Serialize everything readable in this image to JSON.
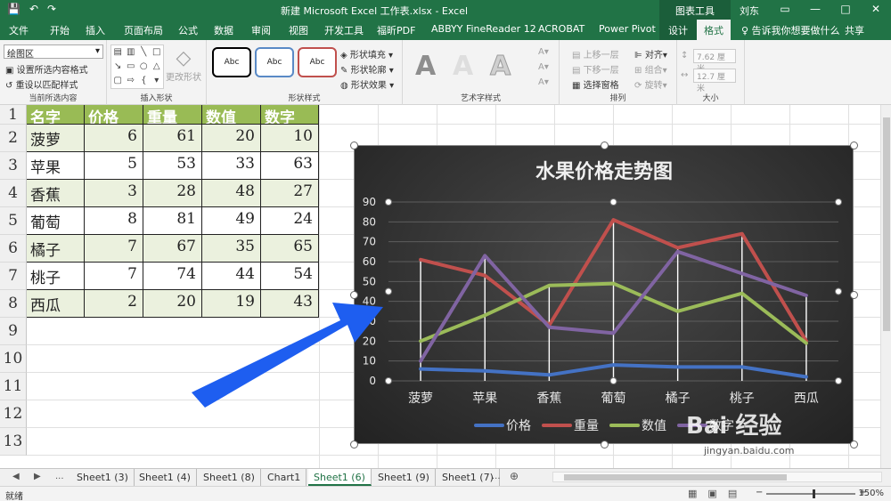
{
  "titlebar": {
    "title": "新建 Microsoft Excel 工作表.xlsx  -  Excel",
    "context_tools": "图表工具",
    "user": "刘东",
    "qat_save": "💾",
    "qat_undo": "↶",
    "qat_redo": "↷",
    "win_restore": "▭",
    "win_min": "—",
    "win_max": "□",
    "win_close": "✕"
  },
  "tabs": [
    {
      "label": "文件"
    },
    {
      "label": "开始"
    },
    {
      "label": "插入"
    },
    {
      "label": "页面布局"
    },
    {
      "label": "公式"
    },
    {
      "label": "数据"
    },
    {
      "label": "审阅"
    },
    {
      "label": "视图"
    },
    {
      "label": "开发工具"
    },
    {
      "label": "福昕PDF"
    },
    {
      "label": "ABBYY FineReader 12"
    },
    {
      "label": "ACROBAT"
    },
    {
      "label": "Power Pivot"
    },
    {
      "label": "设计"
    },
    {
      "label": "格式"
    }
  ],
  "tell_me": "♀ 告诉我你想要做什么",
  "share": "共享",
  "ribbon": {
    "current_selection": {
      "dropdown_value": "绘图区",
      "format_selection": "设置所选内容格式",
      "reset_style": "重设以匹配样式",
      "label": "当前所选内容"
    },
    "insert_shapes": {
      "change_shape": "更改形状",
      "label": "插入形状"
    },
    "shape_styles": {
      "samples": [
        "Abc",
        "Abc",
        "Abc"
      ],
      "fill": "形状填充",
      "outline": "形状轮廓",
      "effects": "形状效果",
      "label": "形状样式"
    },
    "wordart": {
      "letters": [
        "A",
        "A",
        "A"
      ],
      "label": "艺术字样式"
    },
    "arrange": {
      "bring_forward": "上移一层",
      "send_backward": "下移一层",
      "selection_pane": "选择窗格",
      "align": "对齐",
      "group": "组合",
      "rotate": "旋转",
      "label": "排列"
    },
    "size": {
      "height": "7.62 厘米",
      "width": "12.7 厘米",
      "label": "大小"
    }
  },
  "table": {
    "headers": [
      "名字",
      "价格",
      "重量",
      "数值",
      "数字"
    ],
    "rows": [
      {
        "name": "菠萝",
        "v": [
          6,
          61,
          20,
          10
        ]
      },
      {
        "name": "苹果",
        "v": [
          5,
          53,
          33,
          63
        ]
      },
      {
        "name": "香蕉",
        "v": [
          3,
          28,
          48,
          27
        ]
      },
      {
        "name": "葡萄",
        "v": [
          8,
          81,
          49,
          24
        ]
      },
      {
        "name": "橘子",
        "v": [
          7,
          67,
          35,
          65
        ]
      },
      {
        "name": "桃子",
        "v": [
          7,
          74,
          44,
          54
        ]
      },
      {
        "name": "西瓜",
        "v": [
          2,
          20,
          19,
          43
        ]
      }
    ],
    "row_numbers": [
      "1",
      "2",
      "3",
      "4",
      "5",
      "6",
      "7",
      "8",
      "9",
      "10",
      "11",
      "12",
      "13"
    ]
  },
  "chart_data": {
    "type": "line",
    "title": "水果价格走势图",
    "categories": [
      "菠萝",
      "苹果",
      "香蕉",
      "葡萄",
      "橘子",
      "桃子",
      "西瓜"
    ],
    "ylim": [
      0,
      90
    ],
    "yticks": [
      "0",
      "10",
      "20",
      "30",
      "40",
      "50",
      "60",
      "70",
      "80",
      "90"
    ],
    "grid": true,
    "drop_lines": true,
    "legend_position": "bottom",
    "series": [
      {
        "name": "价格",
        "color": "#4472c4",
        "values": [
          6,
          5,
          3,
          8,
          7,
          7,
          2
        ]
      },
      {
        "name": "重量",
        "color": "#c0504d",
        "values": [
          61,
          53,
          28,
          81,
          67,
          74,
          20
        ]
      },
      {
        "name": "数值",
        "color": "#9bbb59",
        "values": [
          20,
          33,
          48,
          49,
          35,
          44,
          19
        ]
      },
      {
        "name": "数字",
        "color": "#8064a2",
        "values": [
          10,
          63,
          27,
          24,
          65,
          54,
          43
        ]
      }
    ]
  },
  "sheets": {
    "nav_prev": "◀",
    "nav_next": "▶",
    "more_left": "...",
    "tabs": [
      "Sheet1 (3)",
      "Sheet1 (4)",
      "Sheet1 (8)",
      "Chart1",
      "Sheet1 (6)",
      "Sheet1 (9)",
      "Sheet1 (7)"
    ],
    "more_right": "...",
    "add": "⊕",
    "active_index": 4
  },
  "status": {
    "ready": "就绪",
    "zoom": "150%",
    "zoom_minus": "−",
    "zoom_plus": "+"
  },
  "watermark": {
    "text": "Bai 经验",
    "sub": "jingyan.baidu.com"
  },
  "colors": {
    "excel_green": "#217346",
    "header_green": "#99bb55",
    "band": "#ebf1de",
    "arrow_blue": "#1e5ef0"
  }
}
